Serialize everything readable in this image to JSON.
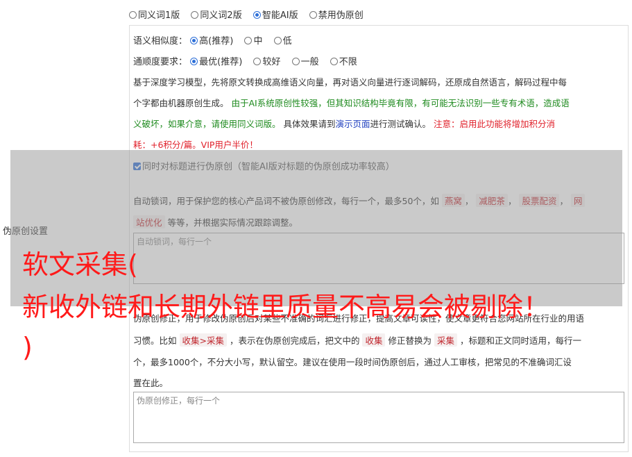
{
  "version_options": [
    {
      "label": "同义词1版",
      "selected": false
    },
    {
      "label": "同义词2版",
      "selected": false
    },
    {
      "label": "智能AI版",
      "selected": true
    },
    {
      "label": "禁用伪原创",
      "selected": false
    }
  ],
  "similarity": {
    "label": "语义相似度：",
    "options": [
      {
        "label": "高(推荐)",
        "selected": true
      },
      {
        "label": "中",
        "selected": false
      },
      {
        "label": "低",
        "selected": false
      }
    ]
  },
  "fluency": {
    "label": "通顺度要求：",
    "options": [
      {
        "label": "最优(推荐)",
        "selected": true
      },
      {
        "label": "较好",
        "selected": false
      },
      {
        "label": "一般",
        "selected": false
      },
      {
        "label": "不限",
        "selected": false
      }
    ]
  },
  "description": {
    "line1": "基于深度学习模型，先将原文转换成高维语义向量，再对语义向量进行逐词解码，还原成自然语言，解码过程中每",
    "line2_plain": "个字都由机器原创生成。",
    "line2_green": "由于AI系统原创性较强，但其知识结构毕竟有限，有可能无法识别一些专有术语，造成语",
    "line3_green": "义破坏，如果介意，请使用同义词版。",
    "line3_plain1": "具体效果请到",
    "line3_link": "演示页面",
    "line3_plain2": "进行测试确认。",
    "line3_red": "注意：启用此功能将增加积分消",
    "line4_red": "耗：+6积分/篇。VIP用户半价！"
  },
  "title_check": {
    "label": "同时对标题进行伪原创（智能AI版对标题的伪原创成功率较高）",
    "checked": true
  },
  "lock_words": {
    "text1": "自动锁词，用于保护您的核心产品词不被伪原创修改，每行一个，最多50个，如",
    "tags": [
      "燕窝",
      "减肥茶",
      "股票配资"
    ],
    "tag_last_part1": "网",
    "tag_last_part2": "站优化",
    "sep": "，",
    "text2": "等等，并根据实际情况跟踪调整。",
    "placeholder": "自动锁词，每行一个"
  },
  "side_label": "伪原创设置",
  "correction": {
    "line1": "伪原创修正，用于修改伪原创后对某些不准确的词汇进行修正，提高文章可读性，使文章更符合您网站所在行业的用语",
    "line2_a": "习惯。比如",
    "tag1": "收集>采集",
    "line2_b": "，表示在伪原创完成后，把文中的",
    "tag2": "收集",
    "line2_c": "修正替换为",
    "tag3": "采集",
    "line2_d": "，标题和正文同时适用，每行一",
    "line3": "个，最多1000个，不分大小写，默认留空。建议在使用一段时间伪原创后，通过人工审核，把常见的不准确词汇设",
    "line4": "置在此。",
    "placeholder": "伪原创修正，每行一个"
  },
  "watermark": {
    "line1": "软文采集(",
    "line2": "新收外链和长期外链里质量不高易会被剔除！",
    "line3": ")"
  },
  "colors": {
    "accent": "#2d6fd8",
    "green": "#1e8a1e",
    "red": "#e0202a",
    "watermark": "#ff1a1a"
  }
}
